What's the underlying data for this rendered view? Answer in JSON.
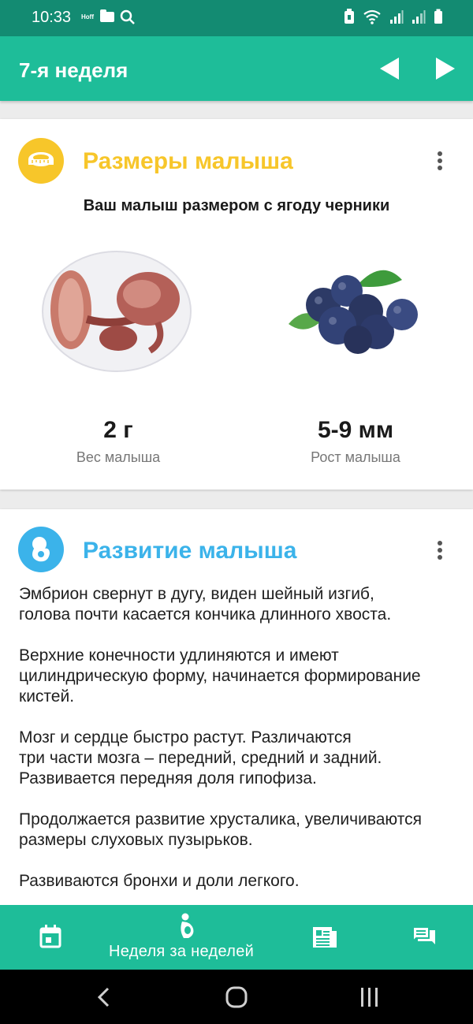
{
  "status_bar": {
    "time": "10:33",
    "hoff": "Hoff"
  },
  "toolbar": {
    "title": "7-я неделя",
    "prev_icon": "chevron-left-icon",
    "next_icon": "chevron-right-icon"
  },
  "size_card": {
    "title": "Размеры малыша",
    "icon": "measuring-tape-icon",
    "subtitle": "Ваш малыш размером с ягоду черники",
    "weight_value": "2 г",
    "weight_label": "Вес малыша",
    "height_value": "5-9 мм",
    "height_label": "Рост малыша"
  },
  "dev_card": {
    "title": "Развитие малыша",
    "icon": "embryo-icon",
    "paragraphs": [
      "Эмбрион свернут в дугу, виден шейный изгиб,\nголова почти касается кончика длинного хвоста.",
      "Верхние конечности удлиняются и имеют\nцилиндрическую форму, начинается формирование\nкистей.",
      "Мозг и сердце быстро растут. Различаются\nтри части мозга – передний, средний и задний.\nРазвивается передняя доля гипофиза.",
      "Продолжается развитие хрусталика, увеличиваются\nразмеры слуховых пузырьков.",
      "Развиваются бронхи и доли легкого."
    ]
  },
  "bottom_nav": {
    "active_label": "Неделя за неделей",
    "items": [
      "calendar-icon",
      "pregnancy-icon",
      "articles-icon",
      "chat-icon"
    ]
  },
  "colors": {
    "status_bar": "#138b72",
    "primary": "#1ebd99",
    "size_accent": "#f7c62a",
    "dev_accent": "#3bb3ea"
  }
}
